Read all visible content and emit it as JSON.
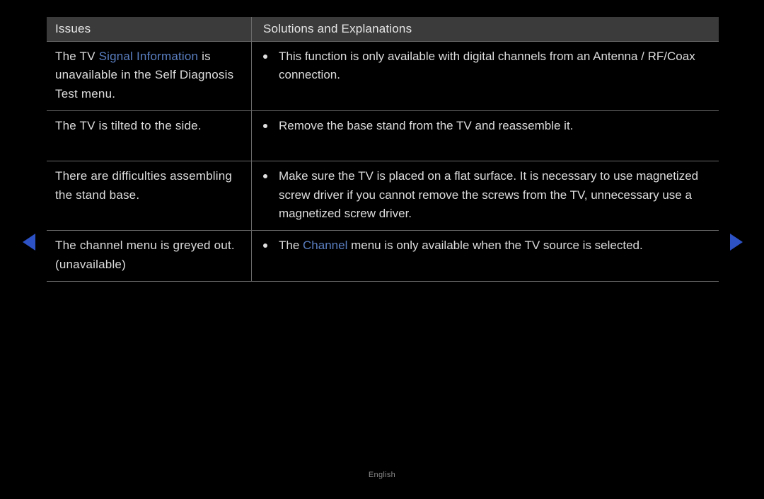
{
  "header": {
    "issues": "Issues",
    "solutions": "Solutions and Explanations"
  },
  "rows": [
    {
      "issue_pre": "The TV ",
      "issue_accent": "Signal Information",
      "issue_post": " is unavailable in the Self Diagnosis Test menu.",
      "solution_pre": "This function is only available with digital channels from an Antenna / RF/Coax connection.",
      "solution_accent": "",
      "solution_post": ""
    },
    {
      "issue_pre": "The TV is tilted to the side.",
      "issue_accent": "",
      "issue_post": "",
      "solution_pre": "Remove the base stand from the TV and reassemble it.",
      "solution_accent": "",
      "solution_post": ""
    },
    {
      "issue_pre": "There are difficulties assembling the stand base.",
      "issue_accent": "",
      "issue_post": "",
      "solution_pre": "Make sure the TV is placed on a flat surface. It is necessary to use magnetized screw driver if you cannot remove the screws from the TV, unnecessary use a magnetized screw driver.",
      "solution_accent": "",
      "solution_post": ""
    },
    {
      "issue_pre": "The channel menu is greyed out. (unavailable)",
      "issue_accent": "",
      "issue_post": "",
      "solution_pre": "The ",
      "solution_accent": "Channel",
      "solution_post": " menu is only available when the TV source is selected."
    }
  ],
  "footer": {
    "language": "English"
  }
}
